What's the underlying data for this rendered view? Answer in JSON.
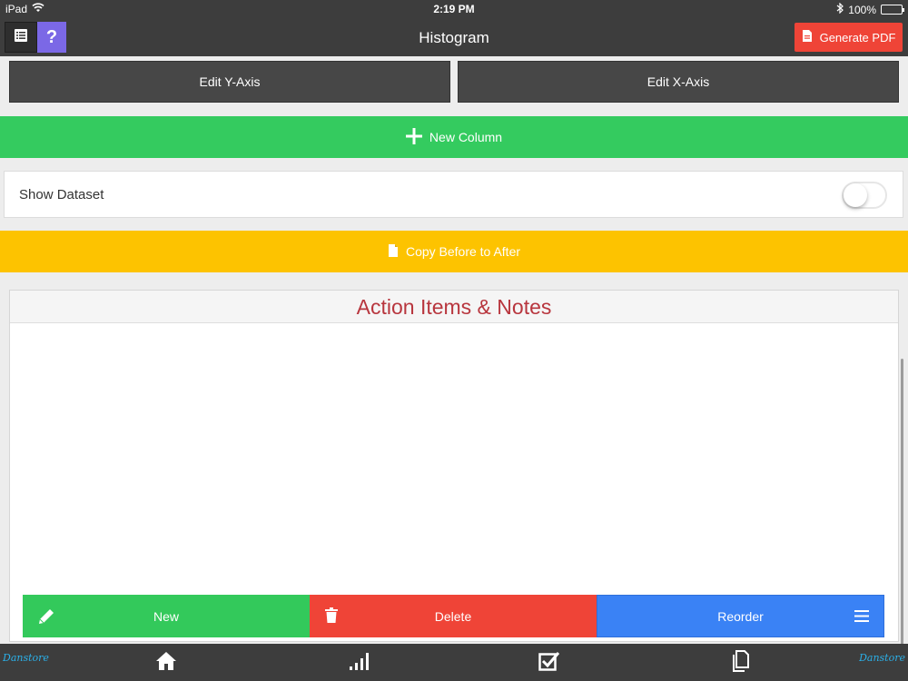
{
  "status_bar": {
    "device": "iPad",
    "time": "2:19 PM",
    "battery": "100%"
  },
  "nav": {
    "help_label": "?",
    "title": "Histogram",
    "pdf_label": "Generate PDF"
  },
  "axis": {
    "y_label": "Edit Y-Axis",
    "x_label": "Edit X-Axis"
  },
  "new_column_label": "New Column",
  "show_dataset": {
    "label": "Show Dataset",
    "enabled": false
  },
  "copy_label": "Copy Before to After",
  "notes": {
    "title": "Action Items & Notes",
    "items": []
  },
  "actions": {
    "new_label": "New",
    "delete_label": "Delete",
    "reorder_label": "Reorder"
  },
  "tab_bar": {
    "brand_left": "Danstore",
    "brand_right": "Danstore",
    "tabs": [
      "home-icon",
      "chart-bars-icon",
      "checkbox-icon",
      "documents-icon"
    ]
  },
  "colors": {
    "dark_bar": "#3d3d3d",
    "help_purple": "#7b68e6",
    "pdf_red": "#ef4437",
    "green": "#34cb5f",
    "yellow": "#fdc300",
    "blue": "#3a82f5",
    "notes_title": "#b8363e"
  }
}
